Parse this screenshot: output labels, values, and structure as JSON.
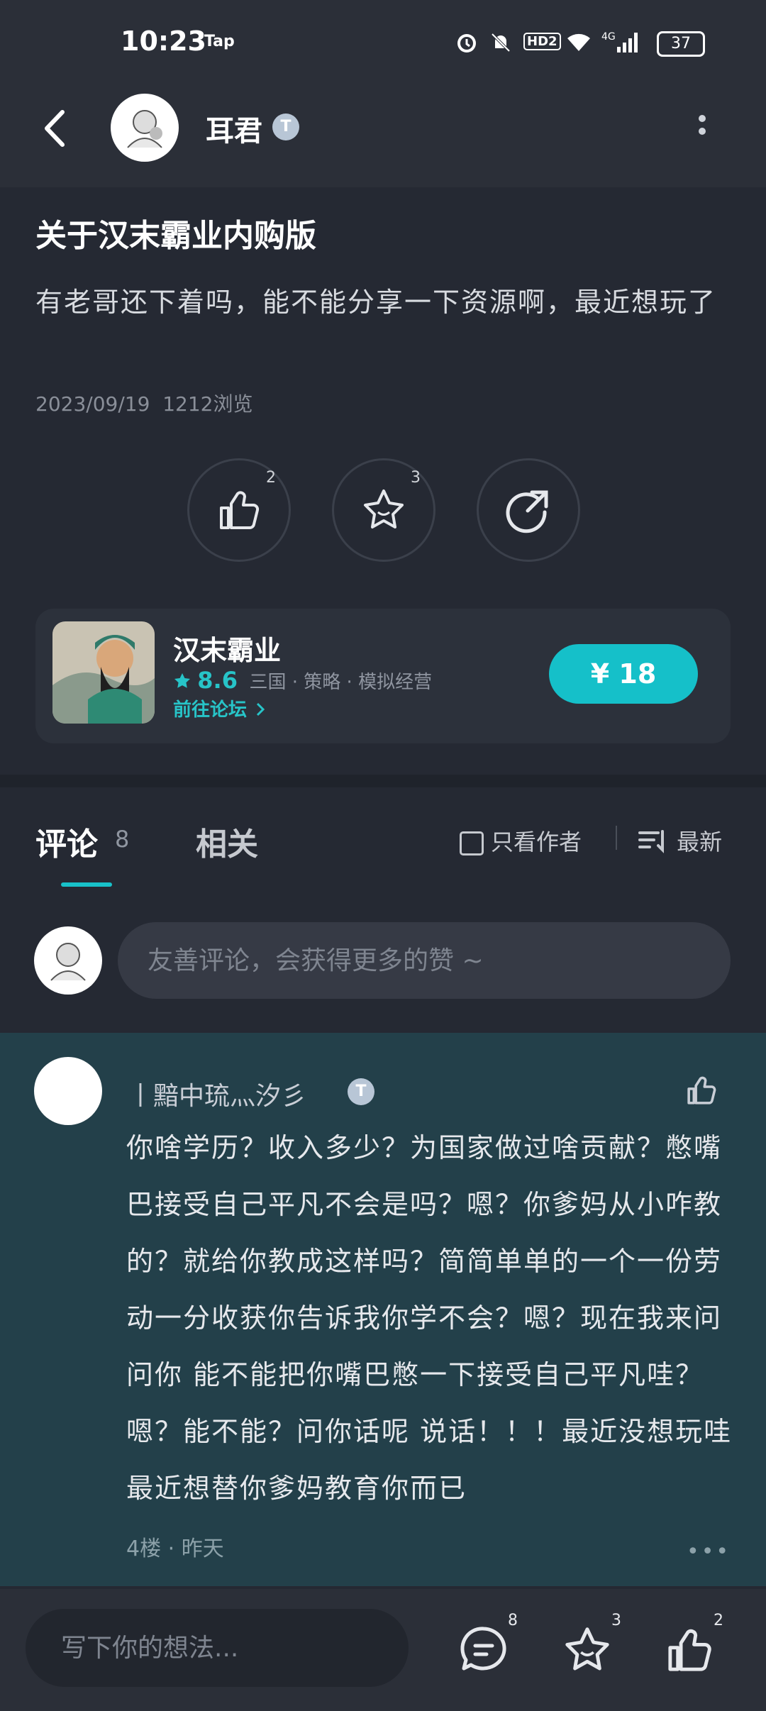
{
  "status_bar": {
    "time": "10:23",
    "tap_label": "Tap",
    "battery": "37",
    "hd_label": "HD2",
    "network": "4G"
  },
  "header": {
    "author_name": "耳君",
    "level_badge": "T"
  },
  "post": {
    "title": "关于汉末霸业内购版",
    "body": "有老哥还下着吗，能不能分享一下资源啊，最近想玩了",
    "date": "2023/09/19",
    "views": "1212浏览",
    "like_count": "2",
    "favorite_count": "3"
  },
  "game_card": {
    "name": "汉末霸业",
    "rating": "8.6",
    "tags": "三国 · 策略 · 模拟经营",
    "forum_link": "前往论坛",
    "price": "¥ 18"
  },
  "tabs": {
    "comments_label": "评论",
    "comments_count": "8",
    "related_label": "相关",
    "author_only": "只看作者",
    "sort": "最新"
  },
  "comment_input": {
    "placeholder": "友善评论，会获得更多的赞 ~"
  },
  "comment": {
    "username": "丨黯中琉灬汐彡",
    "level_badge": "T",
    "text": "你啥学历？收入多少？为国家做过啥贡献？憋嘴巴接受自己平凡不会是吗？嗯？你爹妈从小咋教的？就给你教成这样吗？简简单单的一个一份劳动一分收获你告诉我你学不会？嗯？现在我来问问你 能不能把你嘴巴憋一下接受自己平凡哇？嗯？能不能？问你话呢 说话！！！最近没想玩哇 最近想替你爹妈教育你而已",
    "floor_time": "4楼 · 昨天"
  },
  "bottom_bar": {
    "placeholder": "写下你的想法...",
    "comment_count": "8",
    "favorite_count": "3",
    "like_count": "2"
  },
  "colors": {
    "background": "#252933",
    "accent": "#15c0c9",
    "comment_highlight": "#23404a"
  }
}
